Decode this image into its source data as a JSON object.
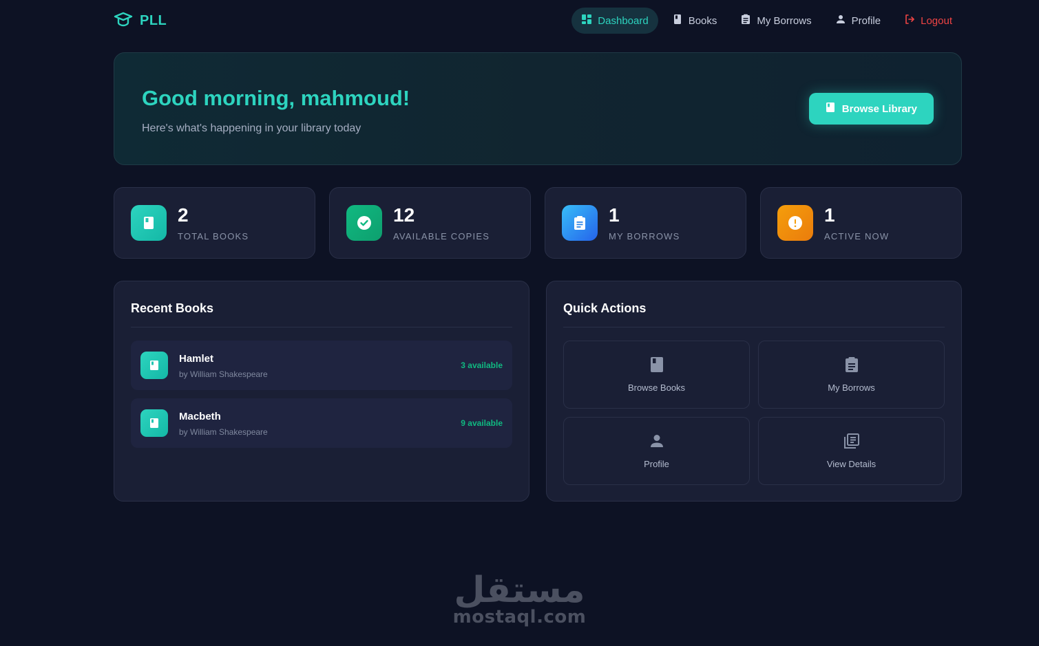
{
  "brand": {
    "name": "PLL",
    "icon": "graduation-cap-icon",
    "color": "#2dd4bf"
  },
  "nav": {
    "items": [
      {
        "label": "Dashboard",
        "icon": "dashboard-icon",
        "active": true
      },
      {
        "label": "Books",
        "icon": "book-icon"
      },
      {
        "label": "My Borrows",
        "icon": "clipboard-icon"
      },
      {
        "label": "Profile",
        "icon": "user-icon"
      },
      {
        "label": "Logout",
        "icon": "logout-icon",
        "color": "#ef4444"
      }
    ]
  },
  "hero": {
    "greeting": "Good morning, mahmoud!",
    "subtitle": "Here's what's happening in your library today",
    "button_label": "Browse Library"
  },
  "stats": [
    {
      "value": "2",
      "label": "TOTAL BOOKS",
      "icon": "book-icon",
      "color": "#2dd4bf"
    },
    {
      "value": "12",
      "label": "AVAILABLE COPIES",
      "icon": "check-circle-icon",
      "color": "#10b981"
    },
    {
      "value": "1",
      "label": "MY BORROWS",
      "icon": "clipboard-icon",
      "color": "#3b82f6"
    },
    {
      "value": "1",
      "label": "ACTIVE NOW",
      "icon": "alert-icon",
      "color": "#f59e0b"
    }
  ],
  "recent_books": {
    "title": "Recent Books",
    "items": [
      {
        "title": "Hamlet",
        "author": "by William Shakespeare",
        "availability": "3 available"
      },
      {
        "title": "Macbeth",
        "author": "by William Shakespeare",
        "availability": "9 available"
      }
    ]
  },
  "quick_actions": {
    "title": "Quick Actions",
    "items": [
      {
        "label": "Browse Books",
        "icon": "book-icon"
      },
      {
        "label": "My Borrows",
        "icon": "clipboard-icon"
      },
      {
        "label": "Profile",
        "icon": "user-icon"
      },
      {
        "label": "View Details",
        "icon": "library-icon"
      }
    ]
  },
  "watermark": {
    "arabic": "مستقل",
    "latin": "mostaql.com"
  }
}
